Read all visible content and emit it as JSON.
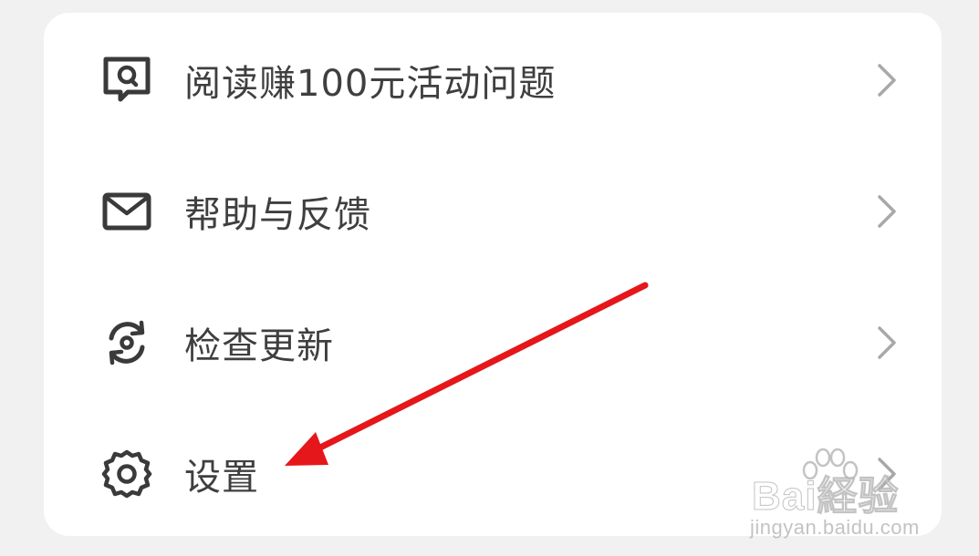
{
  "menu": {
    "items": [
      {
        "label": "阅读赚100元活动问题",
        "icon": "chat-search-icon"
      },
      {
        "label": "帮助与反馈",
        "icon": "mail-icon"
      },
      {
        "label": "检查更新",
        "icon": "refresh-icon"
      },
      {
        "label": "设置",
        "icon": "gear-icon"
      }
    ]
  },
  "annotation": {
    "arrow_color": "#e5171b"
  },
  "watermark": {
    "brand": "Bai経验",
    "brand_prefix": "Bai",
    "brand_du": "du",
    "brand_suffix": "经验",
    "url": "jingyan.baidu.com"
  },
  "colors": {
    "background": "#f1f1f1",
    "card": "#ffffff",
    "text": "#3f3f3f",
    "icon": "#3a3a3a",
    "chevron": "#a8a8a8"
  }
}
